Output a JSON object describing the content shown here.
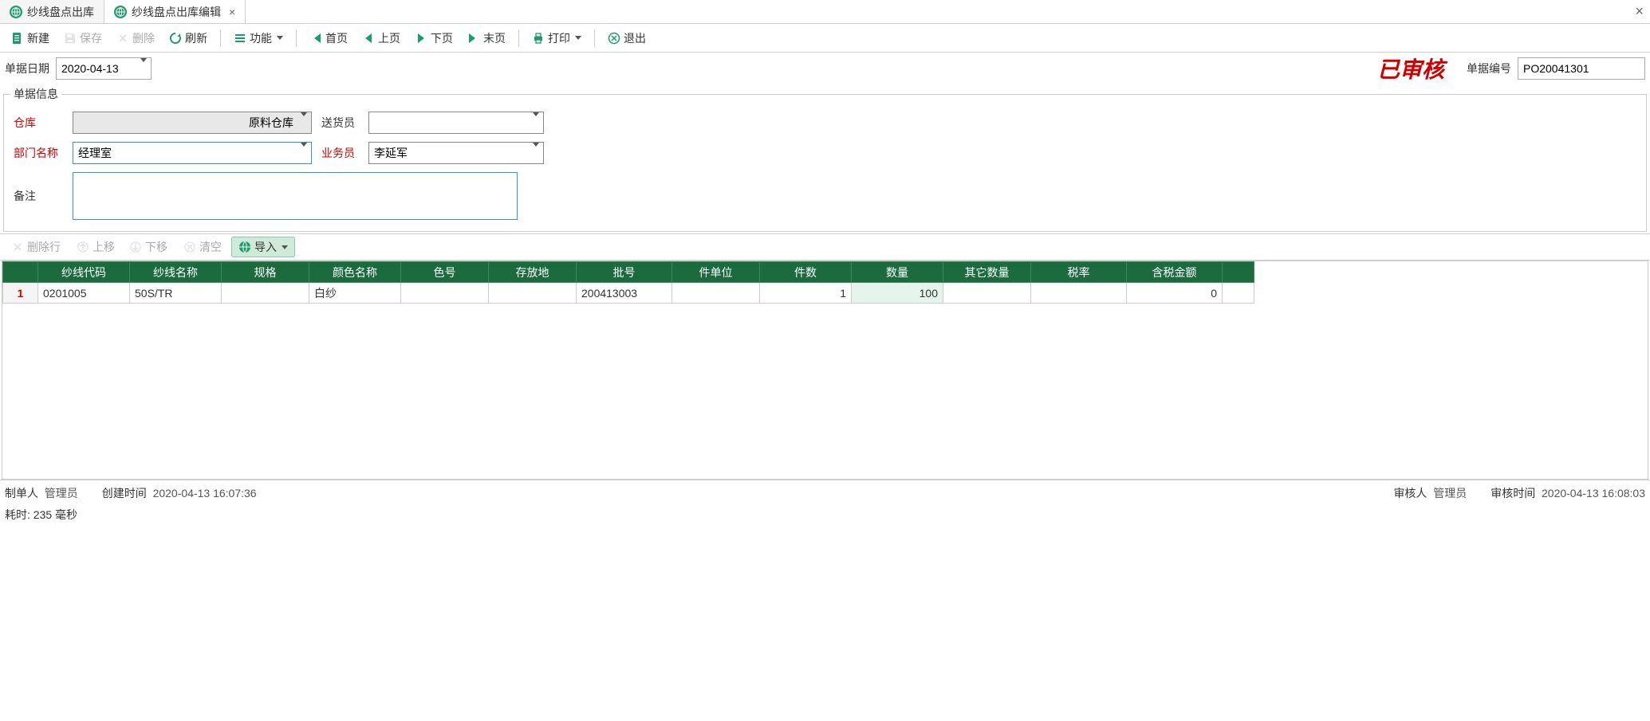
{
  "tabs": [
    {
      "label": "纱线盘点出库",
      "active": false
    },
    {
      "label": "纱线盘点出库编辑",
      "active": true
    }
  ],
  "toolbar": {
    "new": "新建",
    "save": "保存",
    "delete": "删除",
    "refresh": "刷新",
    "functions": "功能",
    "first": "首页",
    "prev": "上页",
    "next": "下页",
    "last": "末页",
    "print": "打印",
    "exit": "退出"
  },
  "topfields": {
    "date_label": "单据日期",
    "date_value": "2020-04-13",
    "audit_stamp": "已审核",
    "docno_label": "单据编号",
    "docno_value": "PO20041301"
  },
  "docinfo": {
    "legend": "单据信息",
    "warehouse_label": "仓库",
    "warehouse_value": "原料仓库",
    "delivery_label": "送货员",
    "delivery_value": "",
    "dept_label": "部门名称",
    "dept_value": "经理室",
    "sales_label": "业务员",
    "sales_value": "李延军",
    "remark_label": "备注",
    "remark_value": ""
  },
  "subtoolbar": {
    "delrow": "删除行",
    "moveup": "上移",
    "movedown": "下移",
    "clear": "清空",
    "import": "导入"
  },
  "grid": {
    "headers": [
      "",
      "纱线代码",
      "纱线名称",
      "规格",
      "颜色名称",
      "色号",
      "存放地",
      "批号",
      "件单位",
      "件数",
      "数量",
      "其它数量",
      "税率",
      "含税金额",
      ""
    ],
    "rows": [
      {
        "num": "1",
        "code": "0201005",
        "name": "50S/TR",
        "spec": "",
        "color": "白纱",
        "colorno": "",
        "location": "",
        "batch": "200413003",
        "unit": "",
        "pieces": "1",
        "qty": "100",
        "otherqty": "",
        "tax": "",
        "amount": "0"
      }
    ]
  },
  "footer": {
    "maker_label": "制单人",
    "maker_value": "管理员",
    "ctime_label": "创建时间",
    "ctime_value": "2020-04-13 16:07:36",
    "auditor_label": "审核人",
    "auditor_value": "管理员",
    "atime_label": "审核时间",
    "atime_value": "2020-04-13 16:08:03"
  },
  "perf": "耗时: 235 毫秒"
}
